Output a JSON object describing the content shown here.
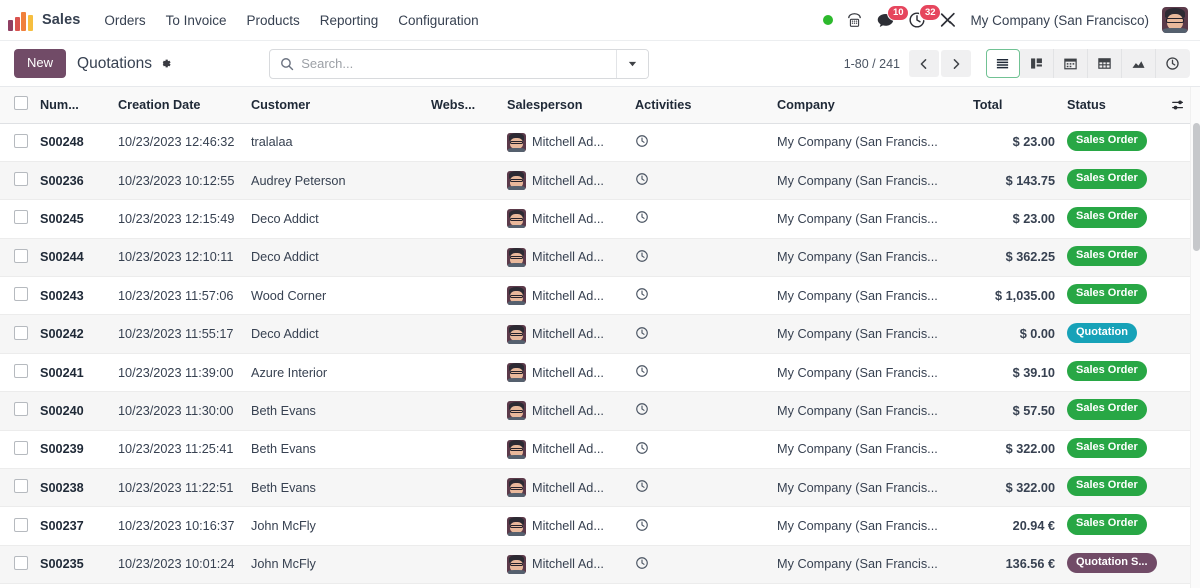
{
  "navbar": {
    "brand": "Sales",
    "logo_icon": "odoo-bars-logo",
    "menu": [
      {
        "label": "Orders"
      },
      {
        "label": "To Invoice"
      },
      {
        "label": "Products"
      },
      {
        "label": "Reporting"
      },
      {
        "label": "Configuration"
      }
    ],
    "presence_icon": "online-status-dot",
    "voip_icon": "phone-icon",
    "messages_icon": "chat-bubble-icon",
    "messages_count": "10",
    "activities_icon": "clock-activity-icon",
    "activities_count": "32",
    "debug_icon": "wrench-tools-icon",
    "company": "My Company (San Francisco)",
    "avatar_icon": "user-avatar"
  },
  "control_panel": {
    "new_label": "New",
    "breadcrumb": "Quotations",
    "settings_icon": "gear-icon",
    "search": {
      "icon": "search-icon",
      "placeholder": "Search...",
      "value": "",
      "dropdown_icon": "caret-down-icon"
    },
    "pager": {
      "range": "1-80 / 241",
      "prev_icon": "chevron-left-icon",
      "next_icon": "chevron-right-icon"
    },
    "views": [
      {
        "name": "list",
        "icon": "list-view-icon",
        "active": true
      },
      {
        "name": "kanban",
        "icon": "kanban-view-icon",
        "active": false
      },
      {
        "name": "calendar",
        "icon": "calendar-view-icon",
        "active": false
      },
      {
        "name": "pivot",
        "icon": "pivot-view-icon",
        "active": false
      },
      {
        "name": "graph",
        "icon": "graph-view-icon",
        "active": false
      },
      {
        "name": "activity",
        "icon": "activity-view-icon",
        "active": false
      }
    ]
  },
  "table": {
    "select_all_icon": "checkbox-unchecked",
    "optional_columns_icon": "column-settings-sliders-icon",
    "columns": [
      {
        "key": "number",
        "label": "Num..."
      },
      {
        "key": "date",
        "label": "Creation Date"
      },
      {
        "key": "customer",
        "label": "Customer"
      },
      {
        "key": "website",
        "label": "Webs..."
      },
      {
        "key": "salesperson",
        "label": "Salesperson"
      },
      {
        "key": "activities",
        "label": "Activities"
      },
      {
        "key": "company",
        "label": "Company"
      },
      {
        "key": "total",
        "label": "Total"
      },
      {
        "key": "status",
        "label": "Status"
      }
    ],
    "rows": [
      {
        "number": "S00248",
        "date": "10/23/2023 12:46:32",
        "customer": "tralalaa",
        "website": "",
        "salesperson": "Mitchell Ad...",
        "activity_icon": "clock-icon",
        "company": "My Company (San Francis...",
        "total": "$ 23.00",
        "total_is_link": false,
        "status": "Sales Order",
        "status_type": "sale"
      },
      {
        "number": "S00236",
        "date": "10/23/2023 10:12:55",
        "customer": "Audrey Peterson",
        "website": "",
        "salesperson": "Mitchell Ad...",
        "activity_icon": "clock-icon",
        "company": "My Company (San Francis...",
        "total": "$ 143.75",
        "total_is_link": false,
        "status": "Sales Order",
        "status_type": "sale"
      },
      {
        "number": "S00245",
        "date": "10/23/2023 12:15:49",
        "customer": "Deco Addict",
        "website": "",
        "salesperson": "Mitchell Ad...",
        "activity_icon": "clock-icon",
        "company": "My Company (San Francis...",
        "total": "$ 23.00",
        "total_is_link": true,
        "status": "Sales Order",
        "status_type": "sale"
      },
      {
        "number": "S00244",
        "date": "10/23/2023 12:10:11",
        "customer": "Deco Addict",
        "website": "",
        "salesperson": "Mitchell Ad...",
        "activity_icon": "clock-icon",
        "company": "My Company (San Francis...",
        "total": "$ 362.25",
        "total_is_link": true,
        "status": "Sales Order",
        "status_type": "sale"
      },
      {
        "number": "S00243",
        "date": "10/23/2023 11:57:06",
        "customer": "Wood Corner",
        "website": "",
        "salesperson": "Mitchell Ad...",
        "activity_icon": "clock-icon",
        "company": "My Company (San Francis...",
        "total": "$ 1,035.00",
        "total_is_link": true,
        "status": "Sales Order",
        "status_type": "sale"
      },
      {
        "number": "S00242",
        "date": "10/23/2023 11:55:17",
        "customer": "Deco Addict",
        "website": "",
        "salesperson": "Mitchell Ad...",
        "activity_icon": "clock-icon",
        "company": "My Company (San Francis...",
        "total": "$ 0.00",
        "total_is_link": false,
        "status": "Quotation",
        "status_type": "draft"
      },
      {
        "number": "S00241",
        "date": "10/23/2023 11:39:00",
        "customer": "Azure Interior",
        "website": "",
        "salesperson": "Mitchell Ad...",
        "activity_icon": "clock-icon",
        "company": "My Company (San Francis...",
        "total": "$ 39.10",
        "total_is_link": true,
        "status": "Sales Order",
        "status_type": "sale"
      },
      {
        "number": "S00240",
        "date": "10/23/2023 11:30:00",
        "customer": "Beth Evans",
        "website": "",
        "salesperson": "Mitchell Ad...",
        "activity_icon": "clock-icon",
        "company": "My Company (San Francis...",
        "total": "$ 57.50",
        "total_is_link": false,
        "status": "Sales Order",
        "status_type": "sale"
      },
      {
        "number": "S00239",
        "date": "10/23/2023 11:25:41",
        "customer": "Beth Evans",
        "website": "",
        "salesperson": "Mitchell Ad...",
        "activity_icon": "clock-icon",
        "company": "My Company (San Francis...",
        "total": "$ 322.00",
        "total_is_link": false,
        "status": "Sales Order",
        "status_type": "sale"
      },
      {
        "number": "S00238",
        "date": "10/23/2023 11:22:51",
        "customer": "Beth Evans",
        "website": "",
        "salesperson": "Mitchell Ad...",
        "activity_icon": "clock-icon",
        "company": "My Company (San Francis...",
        "total": "$ 322.00",
        "total_is_link": false,
        "status": "Sales Order",
        "status_type": "sale"
      },
      {
        "number": "S00237",
        "date": "10/23/2023 10:16:37",
        "customer": "John McFly",
        "website": "",
        "salesperson": "Mitchell Ad...",
        "activity_icon": "clock-icon",
        "company": "My Company (San Francis...",
        "total": "20.94 €",
        "total_is_link": true,
        "status": "Sales Order",
        "status_type": "sale"
      },
      {
        "number": "S00235",
        "date": "10/23/2023 10:01:24",
        "customer": "John McFly",
        "website": "",
        "salesperson": "Mitchell Ad...",
        "activity_icon": "clock-icon",
        "company": "My Company (San Francis...",
        "total": "136.56 €",
        "total_is_link": false,
        "status": "Quotation S...",
        "status_type": "sent"
      }
    ]
  },
  "colors": {
    "brand_purple": "#714b67",
    "status_sale": "#28a745",
    "status_draft": "#17a2b8",
    "status_sent": "#714b67",
    "link_teal": "#017e84",
    "badge_red": "#e6455d",
    "online_green": "#2db92d"
  }
}
